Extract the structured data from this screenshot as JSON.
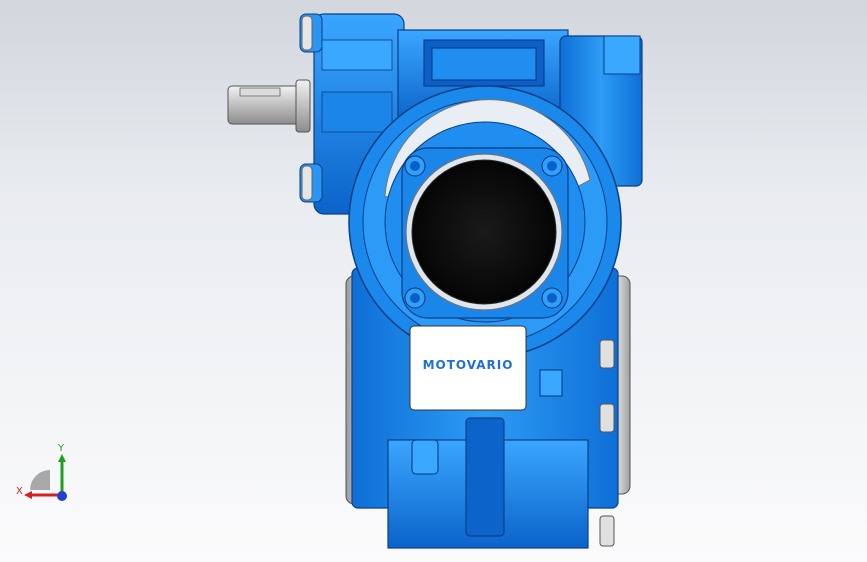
{
  "viewport": {
    "background_top": "#d2d6dd",
    "background_bottom": "#fbfbfc"
  },
  "model": {
    "name_plate": {
      "text": "MOTOVARIO"
    },
    "body_color": "#1e8ff0",
    "body_dark": "#0a5fc2",
    "body_light": "#4bb2ff",
    "bore_color": "#111111",
    "shaft_color": "#c8c8c8"
  },
  "triad": {
    "x_label": "X",
    "y_label": "Y",
    "x_color": "#d42020",
    "y_color": "#20a020",
    "z_color": "#2040d0"
  }
}
